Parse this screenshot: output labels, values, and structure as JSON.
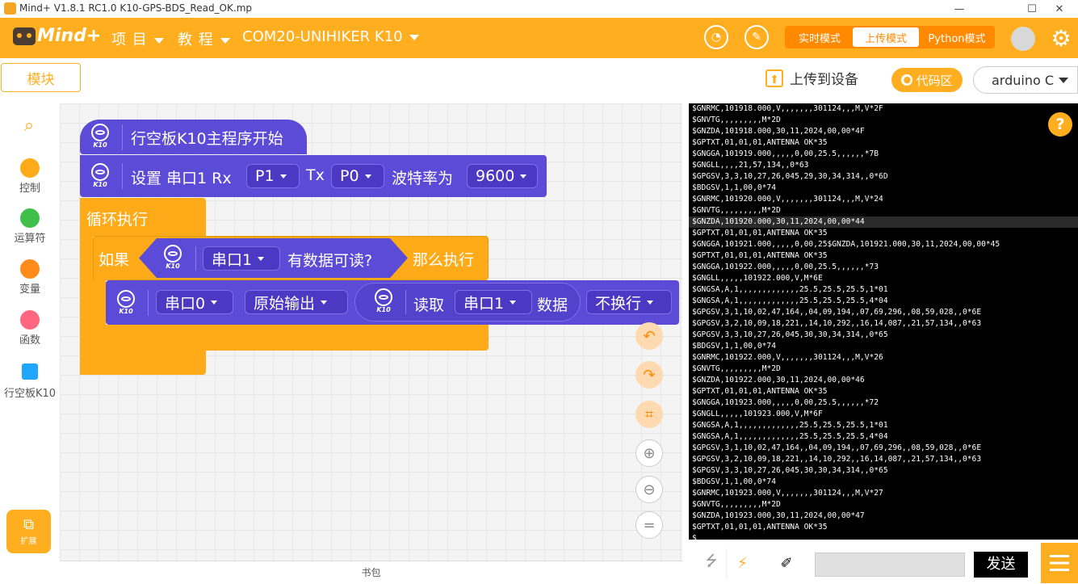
{
  "window": {
    "title": "Mind+ V1.8.1 RC1.0    K10-GPS-BDS_Read_OK.mp",
    "min": "—",
    "max": "☐",
    "close": "✕"
  },
  "topbar": {
    "logo": "Mind+",
    "menu_project": "项 目",
    "menu_tutorial": "教 程",
    "device": "COM20-UNIHIKER K10",
    "modes": [
      "实时模式",
      "上传模式",
      "Python模式"
    ]
  },
  "toolbar": {
    "blocks_tab": "模块",
    "upload_label": "上传到设备",
    "code_area": "代码区",
    "language": "arduino C"
  },
  "sidebar": {
    "categories": [
      {
        "label": "控制",
        "color": "#ffab19"
      },
      {
        "label": "运算符",
        "color": "#40bf4a"
      },
      {
        "label": "变量",
        "color": "#ff8c1a"
      },
      {
        "label": "函数",
        "color": "#ff6680"
      },
      {
        "label": "行空板K10",
        "color": "#1ea7fd"
      }
    ],
    "extension": "扩展"
  },
  "blocks": {
    "k10": "K10",
    "main_start": "行空板K10主程序开始",
    "setup_prefix": "设置 串口1 Rx",
    "rx_pin": "P1",
    "tx_label": "Tx",
    "tx_pin": "P0",
    "baud_label": "波特率为",
    "baud": "9600",
    "loop": "循环执行",
    "if": "如果",
    "serial1": "串口1",
    "has_data": "有数据可读?",
    "then": "那么执行",
    "serial0": "串口0",
    "raw_output": "原始输出",
    "read": "读取",
    "data": "数据",
    "no_newline": "不换行"
  },
  "bookbag": "书包",
  "serial": {
    "highlight_index": 10,
    "lines": [
      "$GNRMC,101918.000,V,,,,,,,301124,,,M,V*2F",
      "$GNVTG,,,,,,,,,M*2D",
      "$GNZDA,101918.000,30,11,2024,00,00*4F",
      "$GPTXT,01,01,01,ANTENNA OK*35",
      "$GNGGA,101919.000,,,,,0,00,25.5,,,,,,*7B",
      "$GNGLL,,,,21,57,134,,0*63",
      "$GPGSV,3,3,10,27,26,045,29,30,34,314,,0*6D",
      "$BDGSV,1,1,00,0*74",
      "$GNRMC,101920.000,V,,,,,,,301124,,,M,V*24",
      "$GNVTG,,,,,,,,,M*2D",
      "$GNZDA,101920.000,30,11,2024,00,00*44",
      "$GPTXT,01,01,01,ANTENNA OK*35",
      "$GNGGA,101921.000,,,,,0,00,25$GNZDA,101921.000,30,11,2024,00,00*45",
      "$GPTXT,01,01,01,ANTENNA OK*35",
      "$GNGGA,101922.000,,,,,0,00,25.5,,,,,,*73",
      "$GNGLL,,,,,101922.000,V,M*6E",
      "$GNGSA,A,1,,,,,,,,,,,,,25.5,25.5,25.5,1*01",
      "$GNGSA,A,1,,,,,,,,,,,,,25.5,25.5,25.5,4*04",
      "$GPGSV,3,1,10,02,47,164,,04,09,194,,07,69,296,,08,59,028,,0*6E",
      "$GPGSV,3,2,10,09,18,221,,14,10,292,,16,14,087,,21,57,134,,0*63",
      "$GPGSV,3,3,10,27,26,045,30,30,34,314,,0*65",
      "$BDGSV,1,1,00,0*74",
      "$GNRMC,101922.000,V,,,,,,,301124,,,M,V*26",
      "$GNVTG,,,,,,,,,M*2D",
      "$GNZDA,101922.000,30,11,2024,00,00*46",
      "$GPTXT,01,01,01,ANTENNA OK*35",
      "$GNGGA,101923.000,,,,,0,00,25.5,,,,,,*72",
      "$GNGLL,,,,,101923.000,V,M*6F",
      "$GNGSA,A,1,,,,,,,,,,,,,25.5,25.5,25.5,1*01",
      "$GNGSA,A,1,,,,,,,,,,,,,25.5,25.5,25.5,4*04",
      "$GPGSV,3,1,10,02,47,164,,04,09,194,,07,69,296,,08,59,028,,0*6E",
      "$GPGSV,3,2,10,09,18,221,,14,10,292,,16,14,087,,21,57,134,,0*63",
      "$GPGSV,3,3,10,27,26,045,30,30,34,314,,0*65",
      "$BDGSV,1,1,00,0*74",
      "$GNRMC,101923.000,V,,,,,,,301124,,,M,V*27",
      "$GNVTG,,,,,,,,,M*2D",
      "$GNZDA,101923.000,30,11,2024,00,00*47",
      "$GPTXT,01,01,01,ANTENNA OK*35",
      "$"
    ],
    "send": "发送"
  }
}
